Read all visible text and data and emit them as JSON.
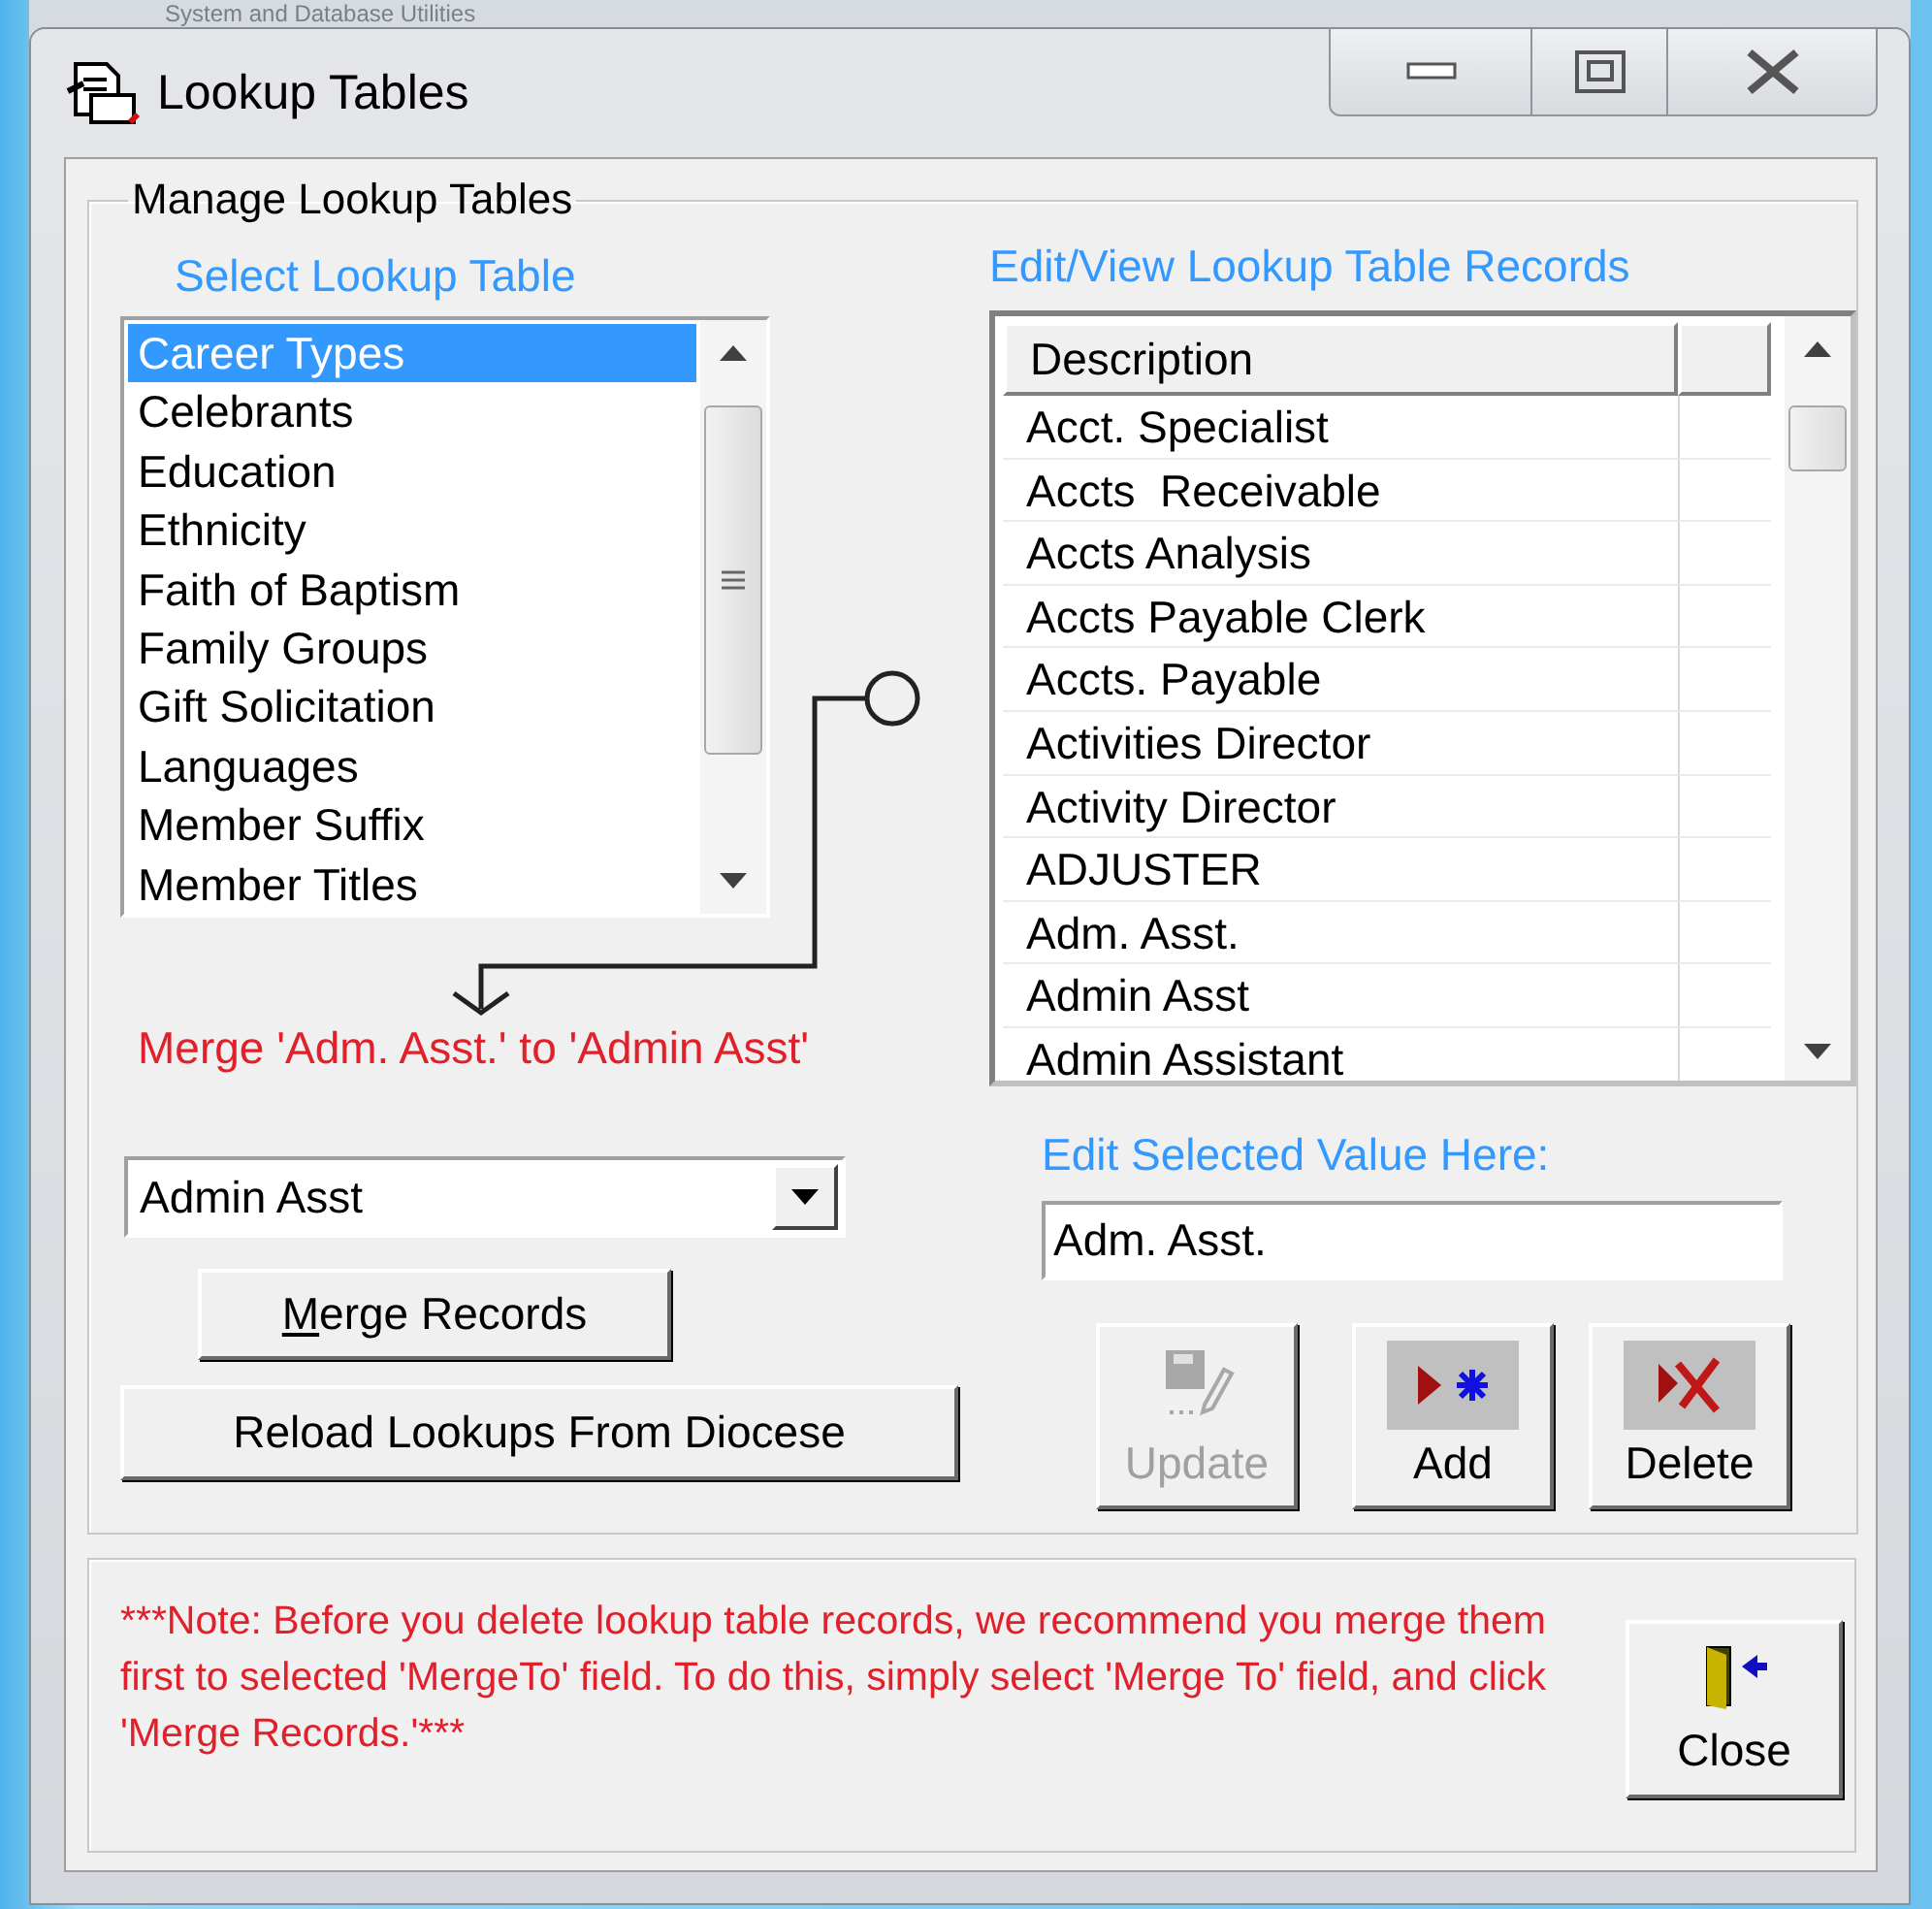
{
  "background_window": {
    "title": "System and Database Utilities"
  },
  "window": {
    "title": "Lookup Tables"
  },
  "manage_group": {
    "title": "Manage Lookup Tables",
    "select_label": "Select Lookup Table",
    "lookup_tables": [
      {
        "label": "Career Types",
        "selected": true
      },
      {
        "label": "Celebrants",
        "selected": false
      },
      {
        "label": "Education",
        "selected": false
      },
      {
        "label": "Ethnicity",
        "selected": false
      },
      {
        "label": "Faith of Baptism",
        "selected": false
      },
      {
        "label": "Family Groups",
        "selected": false
      },
      {
        "label": "Gift Solicitation",
        "selected": false
      },
      {
        "label": "Languages",
        "selected": false
      },
      {
        "label": "Member Suffix",
        "selected": false
      },
      {
        "label": "Member Titles",
        "selected": false
      }
    ],
    "merge_message": "Merge 'Adm. Asst.' to 'Admin Asst'",
    "merge_to": {
      "value": "Admin Asst"
    },
    "merge_button": "Merge Records",
    "reload_button": "Reload Lookups From Diocese",
    "records_label": "Edit/View Lookup Table Records",
    "records_table": {
      "columns": [
        "Description"
      ],
      "rows": [
        "Acct. Specialist",
        "Accts  Receivable",
        "Accts Analysis",
        "Accts Payable Clerk",
        "Accts. Payable",
        "Activities Director",
        "Activity Director",
        "ADJUSTER",
        "Adm. Asst.",
        "Admin Asst",
        "Admin Assistant"
      ]
    },
    "edit_label": "Edit Selected Value Here:",
    "edit_field": {
      "value": "Adm. Asst."
    },
    "actions": [
      {
        "label": "Update",
        "kind": "update",
        "disabled": true
      },
      {
        "label": "Add",
        "kind": "add",
        "disabled": false
      },
      {
        "label": "Delete",
        "kind": "delete",
        "disabled": false
      }
    ]
  },
  "note": {
    "text": "***Note: Before you delete lookup table records, we recommend you merge them first to selected 'MergeTo' field.  To do this, simply select 'Merge To' field, and click 'Merge Records.'***"
  },
  "close_button": "Close"
}
